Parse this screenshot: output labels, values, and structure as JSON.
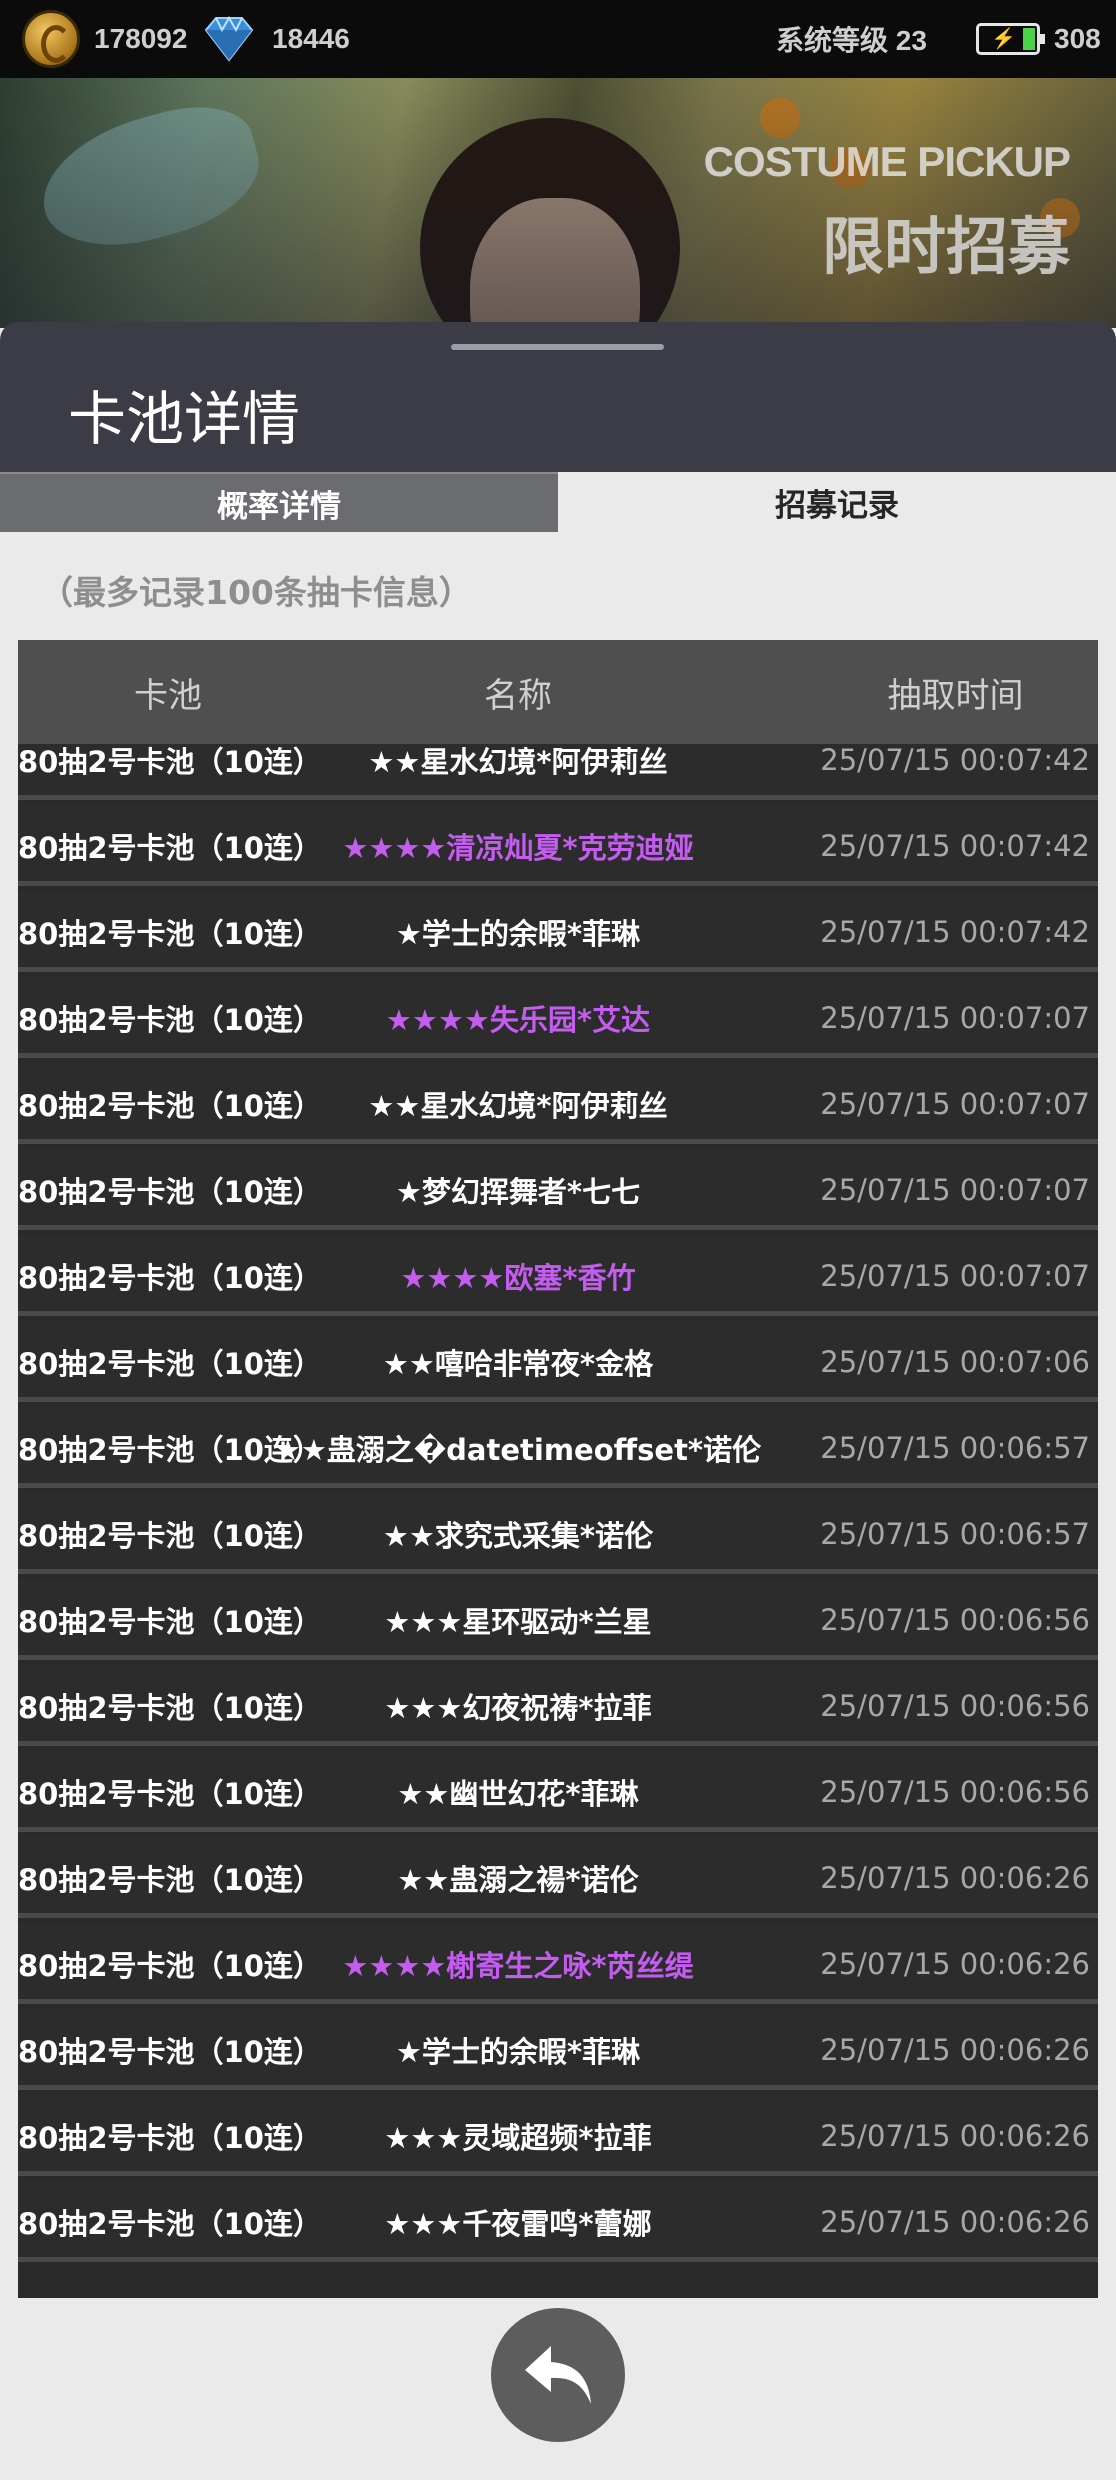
{
  "status": {
    "coins": "178092",
    "gems": "18446",
    "system_level": "系统等级 23",
    "energy": "308",
    "coin_icon": "coin-icon",
    "gem_icon": "diamond-icon",
    "energy_icon": "battery-icon"
  },
  "banner": {
    "title_en": "COSTUME PICKUP",
    "title_cn": "限时招募"
  },
  "panel": {
    "title": "卡池详情"
  },
  "tabs": [
    {
      "label": "概率详情",
      "active": false
    },
    {
      "label": "招募记录",
      "active": true
    }
  ],
  "note": "（最多记录100条抽卡信息）",
  "table": {
    "headers": [
      "卡池",
      "名称",
      "抽取时间"
    ],
    "rows": [
      {
        "pool": "80抽2号卡池（10连）",
        "name": "★★星水幻境*阿伊莉丝",
        "time": "25/07/15 00:07:42",
        "rare": false
      },
      {
        "pool": "80抽2号卡池（10连）",
        "name": "★★★★清凉灿夏*克劳迪娅",
        "time": "25/07/15 00:07:42",
        "rare": true
      },
      {
        "pool": "80抽2号卡池（10连）",
        "name": "★学士的余暇*菲琳",
        "time": "25/07/15 00:07:42",
        "rare": false
      },
      {
        "pool": "80抽2号卡池（10连）",
        "name": "★★★★失乐园*艾达",
        "time": "25/07/15 00:07:07",
        "rare": true
      },
      {
        "pool": "80抽2号卡池（10连）",
        "name": "★★星水幻境*阿伊莉丝",
        "time": "25/07/15 00:07:07",
        "rare": false
      },
      {
        "pool": "80抽2号卡池（10连）",
        "name": "★梦幻挥舞者*七七",
        "time": "25/07/15 00:07:07",
        "rare": false
      },
      {
        "pool": "80抽2号卡池（10连）",
        "name": "★★★★欧塞*香竹",
        "time": "25/07/15 00:07:07",
        "rare": true
      },
      {
        "pool": "80抽2号卡池（10连）",
        "name": "★★嘻哈非常夜*金格",
        "time": "25/07/15 00:07:06",
        "rare": false
      },
      {
        "pool": "80抽2号卡池（10连）",
        "name": "★★蛊溺之�datetimeoffset*诺伦",
        "time": "25/07/15 00:06:57",
        "rare": false
      },
      {
        "pool": "80抽2号卡池（10连）",
        "name": "★★求究式采集*诺伦",
        "time": "25/07/15 00:06:57",
        "rare": false
      },
      {
        "pool": "80抽2号卡池（10连）",
        "name": "★★★星环驱动*兰星",
        "time": "25/07/15 00:06:56",
        "rare": false
      },
      {
        "pool": "80抽2号卡池（10连）",
        "name": "★★★幻夜祝祷*拉菲",
        "time": "25/07/15 00:06:56",
        "rare": false
      },
      {
        "pool": "80抽2号卡池（10连）",
        "name": "★★幽世幻花*菲琳",
        "time": "25/07/15 00:06:56",
        "rare": false
      },
      {
        "pool": "80抽2号卡池（10连）",
        "name": "★★蛊溺之禓*诺伦",
        "time": "25/07/15 00:06:26",
        "rare": false
      },
      {
        "pool": "80抽2号卡池（10连）",
        "name": "★★★★榭寄生之咏*芮丝缇",
        "time": "25/07/15 00:06:26",
        "rare": true
      },
      {
        "pool": "80抽2号卡池（10连）",
        "name": "★学士的余暇*菲琳",
        "time": "25/07/15 00:06:26",
        "rare": false
      },
      {
        "pool": "80抽2号卡池（10连）",
        "name": "★★★灵域超频*拉菲",
        "time": "25/07/15 00:06:26",
        "rare": false
      },
      {
        "pool": "80抽2号卡池（10连）",
        "name": "★★★千夜雷鸣*蕾娜",
        "time": "25/07/15 00:06:26",
        "rare": false
      }
    ]
  },
  "back_button": {
    "icon": "back-arrow-icon"
  },
  "colors": {
    "rare_name": "#c45cf0",
    "normal_name": "#ffffff",
    "time_text": "#a8a8a8",
    "panel_header": "#3b3c46"
  }
}
